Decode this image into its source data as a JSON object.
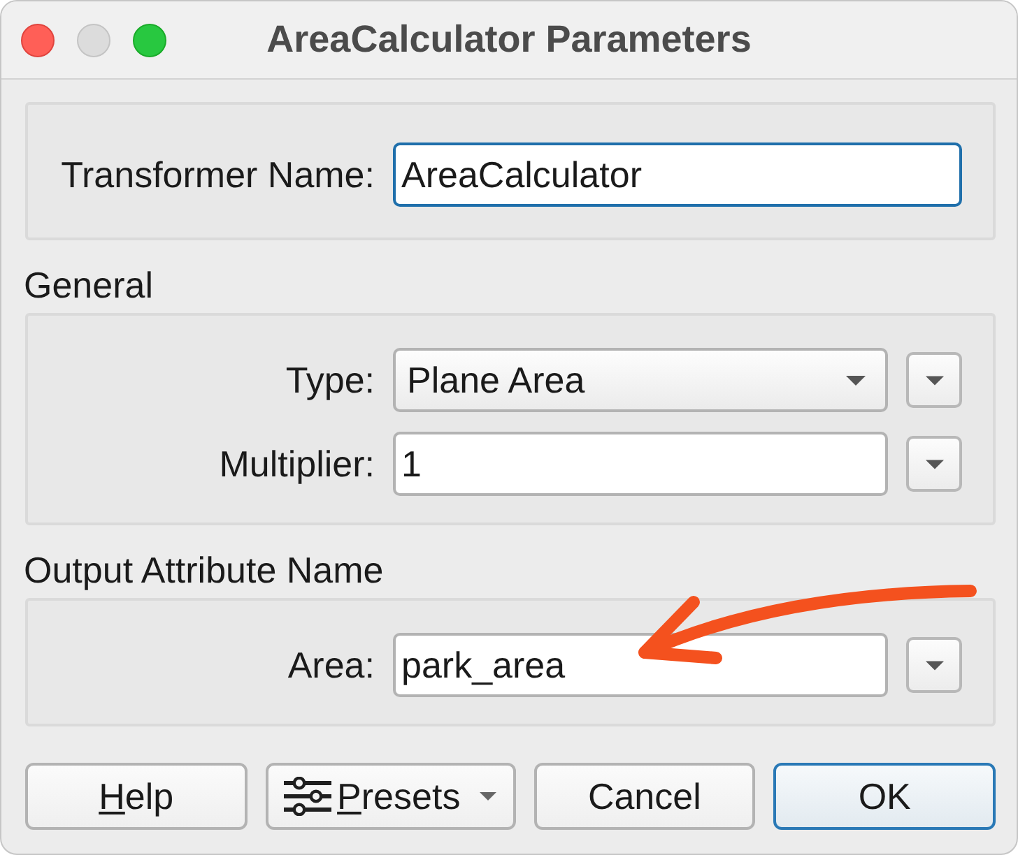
{
  "window": {
    "title": "AreaCalculator Parameters",
    "controls": [
      {
        "kind": "close",
        "disabled": false
      },
      {
        "kind": "minimize",
        "disabled": true
      },
      {
        "kind": "zoom",
        "disabled": false
      }
    ]
  },
  "sections": [
    {
      "fields": [
        {
          "kind": "text",
          "label": "Transformer Name:",
          "value": "AreaCalculator",
          "focused": true,
          "menu_button": false
        }
      ]
    },
    {
      "title": "General",
      "fields": [
        {
          "kind": "dropdown",
          "label": "Type:",
          "value": "Plane Area",
          "focused": false,
          "menu_button": true
        },
        {
          "kind": "text",
          "label": "Multiplier:",
          "value": "1",
          "focused": false,
          "menu_button": true
        }
      ]
    },
    {
      "title": "Output Attribute Name",
      "fields": [
        {
          "kind": "text",
          "label": "Area:",
          "value": "park_area",
          "focused": false,
          "menu_button": true,
          "annotation": {
            "kind": "arrow"
          }
        }
      ]
    }
  ],
  "buttons": [
    {
      "kind": "plain",
      "label": "Help",
      "mnemonic": true,
      "default": false
    },
    {
      "kind": "menu",
      "label": "Presets",
      "mnemonic": true,
      "default": false
    },
    {
      "kind": "plain",
      "label": "Cancel",
      "mnemonic": false,
      "default": false
    },
    {
      "kind": "plain",
      "label": "OK",
      "mnemonic": false,
      "default": true
    }
  ]
}
